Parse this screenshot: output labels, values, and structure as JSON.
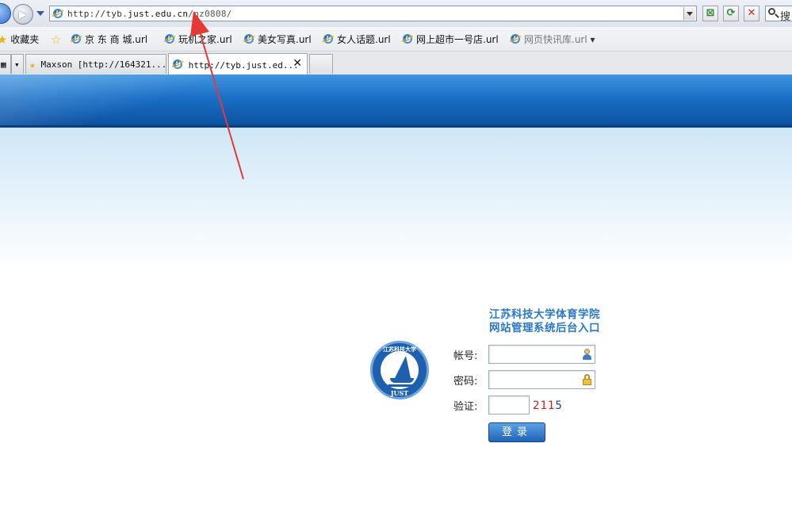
{
  "browser": {
    "address": {
      "scheme_host": "http://tyb.",
      "host": "just.edu.cn",
      "path": "/nz0808/"
    },
    "search_placeholder": "搜",
    "favorites_label": "收藏夹",
    "favorites": [
      {
        "label": "京 东 商 城.url"
      },
      {
        "label": "玩机之家.url"
      },
      {
        "label": "美女写真.url"
      },
      {
        "label": "女人话题.url"
      },
      {
        "label": "网上超市一号店.url"
      },
      {
        "label": "网页快讯库.url"
      }
    ],
    "tabs": [
      {
        "label": "Maxson [http://164321...",
        "active": false
      },
      {
        "label": "http://tyb.just.ed...",
        "active": true
      }
    ]
  },
  "login": {
    "title_line1": "江苏科技大学体育学院",
    "title_line2": "网站管理系统后台入口",
    "logo_text": "JUST",
    "logo_caption": "江苏科技大学",
    "account_label": "帐号:",
    "account_value": "",
    "password_label": "密码:",
    "password_value": "",
    "verify_label": "验证:",
    "verify_value": "",
    "captcha": [
      "2",
      "1",
      "1",
      "5"
    ],
    "captcha_colors": [
      "#c62020",
      "#c62020",
      "#c62020",
      "#1e3fa6"
    ],
    "submit_label": "登录"
  },
  "colors": {
    "banner": "#1a6fc7",
    "title": "#2a77c8",
    "annotation_arrow": "#e53935"
  }
}
